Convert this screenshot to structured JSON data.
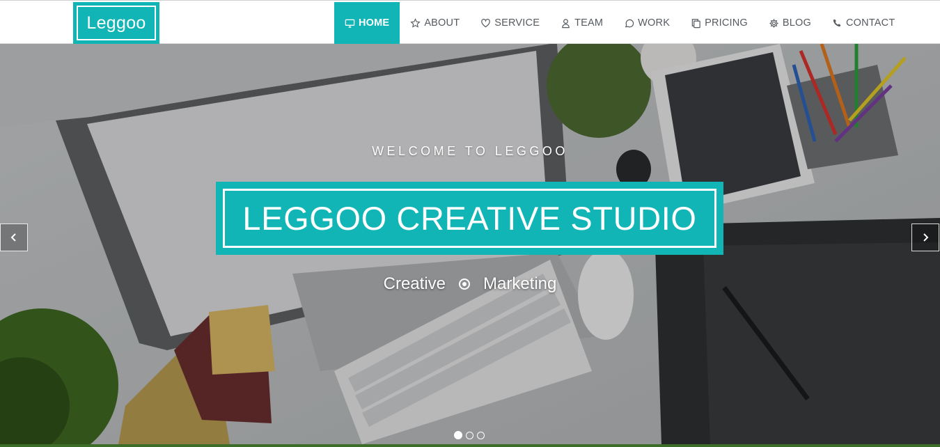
{
  "brand": {
    "logo_text": "Leggoo",
    "accent_color": "#12b5b5"
  },
  "nav": {
    "items": [
      {
        "label": "HOME",
        "icon": "monitor-icon",
        "active": true
      },
      {
        "label": "ABOUT",
        "icon": "star-icon",
        "active": false
      },
      {
        "label": "SERVICE",
        "icon": "heart-icon",
        "active": false
      },
      {
        "label": "TEAM",
        "icon": "user-icon",
        "active": false
      },
      {
        "label": "WORK",
        "icon": "speech-bubble-icon",
        "active": false
      },
      {
        "label": "PRICING",
        "icon": "copy-icon",
        "active": false
      },
      {
        "label": "BLOG",
        "icon": "gear-icon",
        "active": false
      },
      {
        "label": "CONTACT",
        "icon": "phone-icon",
        "active": false
      }
    ]
  },
  "hero": {
    "tagline": "WELCOME TO LEGGOO",
    "title": "LEGGOO CREATIVE STUDIO",
    "subtitle_left": "Creative",
    "subtitle_separator_icon": "dot-circle-icon",
    "subtitle_right": "Marketing",
    "prev_icon": "chevron-left-icon",
    "next_icon": "chevron-right-icon",
    "slides_total": 3,
    "active_slide": 1
  }
}
